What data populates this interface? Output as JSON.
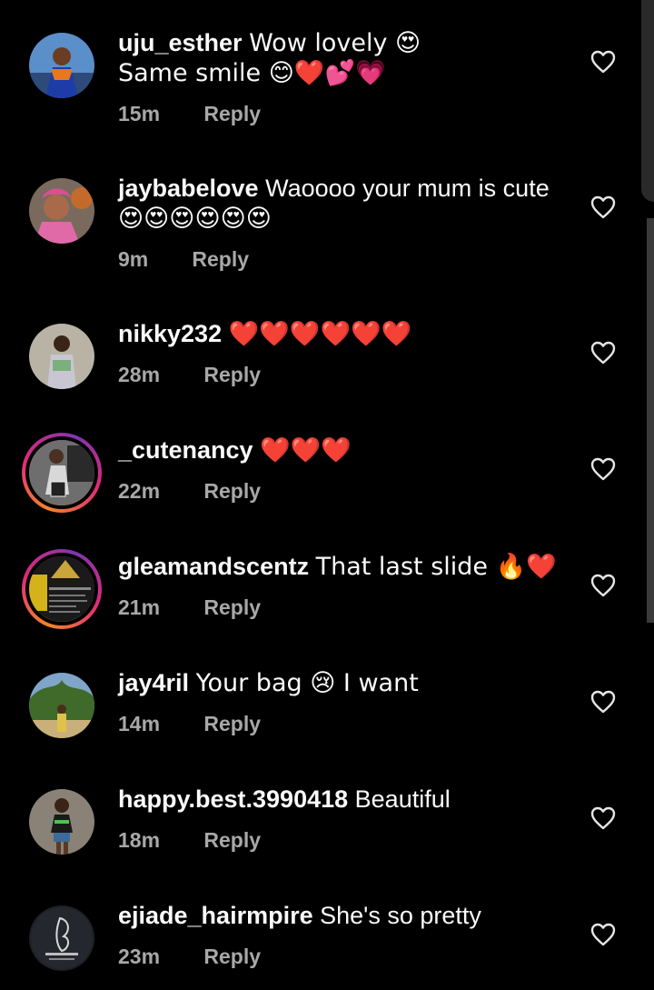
{
  "comments": [
    {
      "username": "uju_esther",
      "text": "Wow lovely 😍",
      "text2": "Same smile 😊❤️💕💗",
      "time": "15m",
      "reply": "Reply",
      "avatar_icon": "avatar-photo",
      "story_ring": false
    },
    {
      "username": "jaybabelove",
      "text": "Waoooo your mum is cute",
      "text2": "😍😍😍😍😍😍",
      "time": "9m",
      "reply": "Reply",
      "avatar_icon": "avatar-photo",
      "story_ring": false
    },
    {
      "username": "nikky232",
      "text": "❤️❤️❤️❤️❤️❤️",
      "time": "28m",
      "reply": "Reply",
      "avatar_icon": "avatar-photo",
      "story_ring": false
    },
    {
      "username": "_cutenancy",
      "text": "❤️❤️❤️",
      "time": "22m",
      "reply": "Reply",
      "avatar_icon": "avatar-photo",
      "story_ring": true
    },
    {
      "username": "gleamandscentz",
      "text": "That last slide 🔥❤️",
      "time": "21m",
      "reply": "Reply",
      "avatar_icon": "avatar-photo",
      "story_ring": true
    },
    {
      "username": "jay4ril",
      "text": "Your bag 😢 I want",
      "time": "14m",
      "reply": "Reply",
      "avatar_icon": "avatar-photo",
      "story_ring": false
    },
    {
      "username": "happy.best.3990418",
      "text": "Beautiful",
      "time": "18m",
      "reply": "Reply",
      "avatar_icon": "avatar-photo",
      "story_ring": false
    },
    {
      "username": "ejiade_hairmpire",
      "text": "She's so pretty",
      "time": "23m",
      "reply": "Reply",
      "avatar_icon": "avatar-logo",
      "story_ring": false
    }
  ],
  "icons": {
    "like": "heart-outline-icon"
  },
  "colors": {
    "background": "#000000",
    "primary_text": "#fafafa",
    "secondary_text": "#a8a8a8",
    "story_ring_start": "#f58529",
    "story_ring_end": "#dd2a7b"
  }
}
